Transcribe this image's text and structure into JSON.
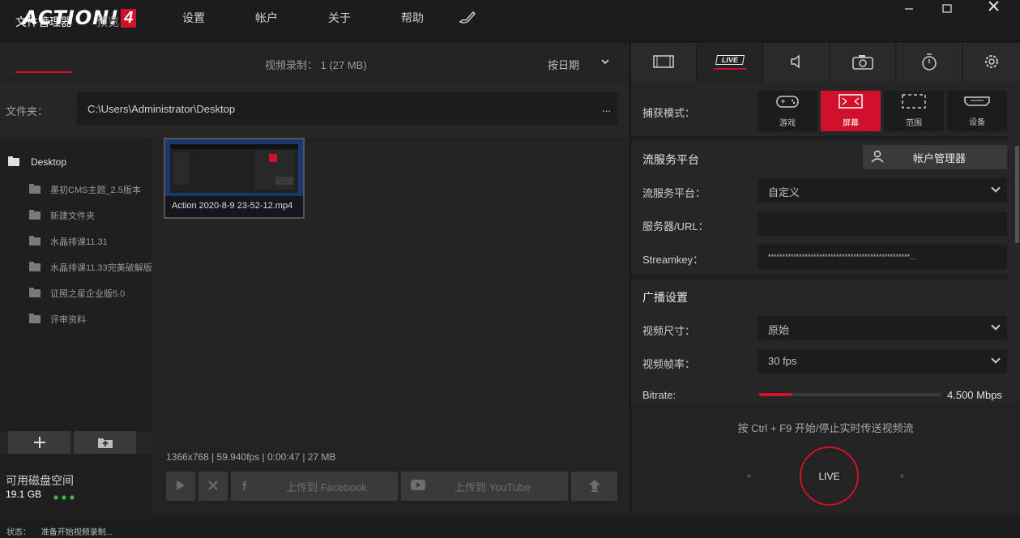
{
  "app": {
    "logo_text": "ACTION!",
    "logo_num": "4"
  },
  "menu": [
    "设置",
    "帐户",
    "关于",
    "帮助"
  ],
  "left": {
    "tabs": {
      "file_manager": "文件管理器",
      "preview": "预览"
    },
    "recording_info": "视频录制： 1 (27 MB)",
    "sort_label": "按日期",
    "folder_label": "文件夹：",
    "folder_path": "C:\\Users\\Administrator\\Desktop",
    "folder_more": "...",
    "tree_root": "Desktop",
    "tree_items": [
      "墨初CMS主题_2.5版本",
      "新建文件夹",
      "水晶排课11.31",
      "水晶排课11.33完美破解版",
      "证照之星企业版5.0",
      "评审资料"
    ],
    "disk_label": "可用磁盘空间",
    "disk_value": "19.1 GB",
    "thumb_caption": "Action 2020-8-9 23-52-12.mp4",
    "file_info": "1366x768 | 59.940fps | 0:00:47 | 27 MB",
    "upload_facebook": "上传到 Facebook",
    "upload_youtube": "上传到 YouTube"
  },
  "right": {
    "capture_label": "捕获模式：",
    "capture_modes": [
      "游戏",
      "屏幕",
      "范围",
      "设备"
    ],
    "stream_section": "流服务平台",
    "account_manager": "帐户管理器",
    "platform_label": "流服务平台：",
    "platform_value": "自定义",
    "server_label": "服务器/URL：",
    "server_value": "",
    "streamkey_label": "Streamkey：",
    "streamkey_value": "**************************************************...",
    "broadcast_section": "广播设置",
    "size_label": "视频尺寸：",
    "size_value": "原始",
    "fps_label": "视频帧率：",
    "fps_value": "30 fps",
    "bitrate_label": "Bitrate:",
    "bitrate_value": "4.500 Mbps",
    "bitrate_fraction": 0.18,
    "hint": "按 Ctrl + F9 开始/停止实时传送视频流",
    "live_button": "LIVE",
    "live_tab": "LIVE"
  },
  "status": {
    "label": "状态：",
    "text": "准备开始视频录制..."
  },
  "colors": {
    "accent": "#d0112b"
  }
}
